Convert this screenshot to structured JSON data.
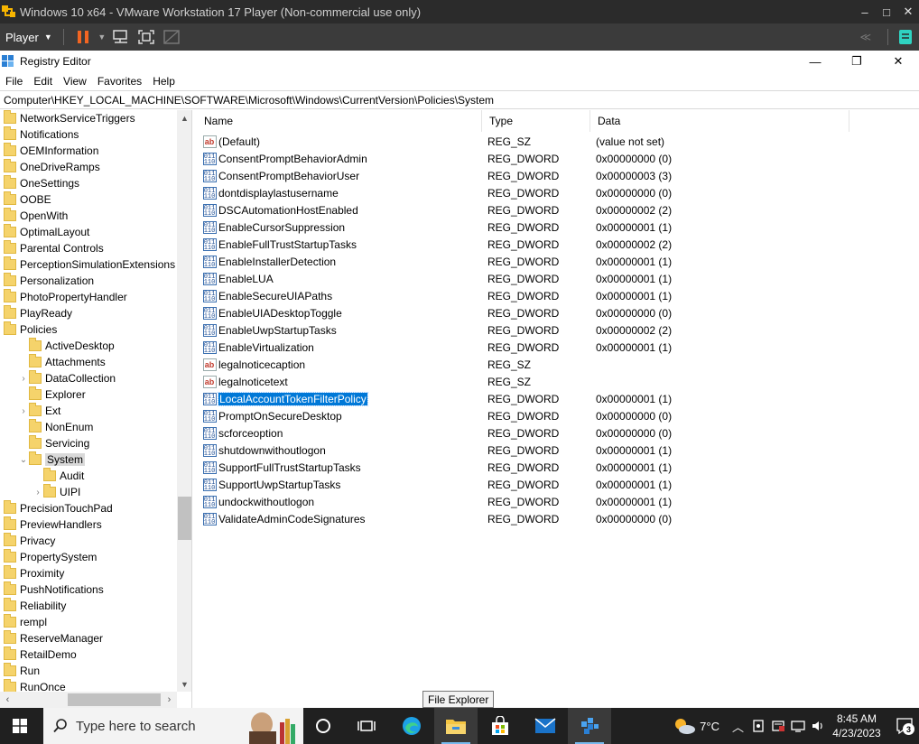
{
  "vm": {
    "title": "Windows 10 x64 - VMware Workstation 17 Player (Non-commercial use only)",
    "player_label": "Player",
    "win_controls": [
      "–",
      "□",
      "✕"
    ]
  },
  "regedit": {
    "title": "Registry Editor",
    "win_controls": [
      "—",
      "❐",
      "✕"
    ],
    "menu": [
      "File",
      "Edit",
      "View",
      "Favorites",
      "Help"
    ],
    "address": "Computer\\HKEY_LOCAL_MACHINE\\SOFTWARE\\Microsoft\\Windows\\CurrentVersion\\Policies\\System",
    "tree": [
      {
        "label": "NetworkServiceTriggers",
        "level": 0,
        "exp": ""
      },
      {
        "label": "Notifications",
        "level": 0,
        "exp": ""
      },
      {
        "label": "OEMInformation",
        "level": 0,
        "exp": ""
      },
      {
        "label": "OneDriveRamps",
        "level": 0,
        "exp": ""
      },
      {
        "label": "OneSettings",
        "level": 0,
        "exp": ""
      },
      {
        "label": "OOBE",
        "level": 0,
        "exp": ""
      },
      {
        "label": "OpenWith",
        "level": 0,
        "exp": ""
      },
      {
        "label": "OptimalLayout",
        "level": 0,
        "exp": ""
      },
      {
        "label": "Parental Controls",
        "level": 0,
        "exp": ""
      },
      {
        "label": "PerceptionSimulationExtensions",
        "level": 0,
        "exp": ""
      },
      {
        "label": "Personalization",
        "level": 0,
        "exp": ""
      },
      {
        "label": "PhotoPropertyHandler",
        "level": 0,
        "exp": ""
      },
      {
        "label": "PlayReady",
        "level": 0,
        "exp": ""
      },
      {
        "label": "Policies",
        "level": 0,
        "exp": ""
      },
      {
        "label": "ActiveDesktop",
        "level": 1,
        "exp": ""
      },
      {
        "label": "Attachments",
        "level": 1,
        "exp": ""
      },
      {
        "label": "DataCollection",
        "level": 1,
        "exp": "›"
      },
      {
        "label": "Explorer",
        "level": 1,
        "exp": ""
      },
      {
        "label": "Ext",
        "level": 1,
        "exp": "›"
      },
      {
        "label": "NonEnum",
        "level": 1,
        "exp": ""
      },
      {
        "label": "Servicing",
        "level": 1,
        "exp": ""
      },
      {
        "label": "System",
        "level": 1,
        "exp": "⌄",
        "selected": true
      },
      {
        "label": "Audit",
        "level": 2,
        "exp": ""
      },
      {
        "label": "UIPI",
        "level": 2,
        "exp": "›"
      },
      {
        "label": "PrecisionTouchPad",
        "level": 0,
        "exp": ""
      },
      {
        "label": "PreviewHandlers",
        "level": 0,
        "exp": ""
      },
      {
        "label": "Privacy",
        "level": 0,
        "exp": ""
      },
      {
        "label": "PropertySystem",
        "level": 0,
        "exp": ""
      },
      {
        "label": "Proximity",
        "level": 0,
        "exp": ""
      },
      {
        "label": "PushNotifications",
        "level": 0,
        "exp": ""
      },
      {
        "label": "Reliability",
        "level": 0,
        "exp": ""
      },
      {
        "label": "rempl",
        "level": 0,
        "exp": ""
      },
      {
        "label": "ReserveManager",
        "level": 0,
        "exp": ""
      },
      {
        "label": "RetailDemo",
        "level": 0,
        "exp": ""
      },
      {
        "label": "Run",
        "level": 0,
        "exp": ""
      },
      {
        "label": "RunOnce",
        "level": 0,
        "exp": ""
      }
    ],
    "columns": [
      "Name",
      "Type",
      "Data"
    ],
    "values": [
      {
        "name": "(Default)",
        "type": "REG_SZ",
        "data": "(value not set)",
        "icon": "string-value-icon"
      },
      {
        "name": "ConsentPromptBehaviorAdmin",
        "type": "REG_DWORD",
        "data": "0x00000000 (0)",
        "icon": "dword-value-icon"
      },
      {
        "name": "ConsentPromptBehaviorUser",
        "type": "REG_DWORD",
        "data": "0x00000003 (3)",
        "icon": "dword-value-icon"
      },
      {
        "name": "dontdisplaylastusername",
        "type": "REG_DWORD",
        "data": "0x00000000 (0)",
        "icon": "dword-value-icon"
      },
      {
        "name": "DSCAutomationHostEnabled",
        "type": "REG_DWORD",
        "data": "0x00000002 (2)",
        "icon": "dword-value-icon"
      },
      {
        "name": "EnableCursorSuppression",
        "type": "REG_DWORD",
        "data": "0x00000001 (1)",
        "icon": "dword-value-icon"
      },
      {
        "name": "EnableFullTrustStartupTasks",
        "type": "REG_DWORD",
        "data": "0x00000002 (2)",
        "icon": "dword-value-icon"
      },
      {
        "name": "EnableInstallerDetection",
        "type": "REG_DWORD",
        "data": "0x00000001 (1)",
        "icon": "dword-value-icon"
      },
      {
        "name": "EnableLUA",
        "type": "REG_DWORD",
        "data": "0x00000001 (1)",
        "icon": "dword-value-icon"
      },
      {
        "name": "EnableSecureUIAPaths",
        "type": "REG_DWORD",
        "data": "0x00000001 (1)",
        "icon": "dword-value-icon"
      },
      {
        "name": "EnableUIADesktopToggle",
        "type": "REG_DWORD",
        "data": "0x00000000 (0)",
        "icon": "dword-value-icon"
      },
      {
        "name": "EnableUwpStartupTasks",
        "type": "REG_DWORD",
        "data": "0x00000002 (2)",
        "icon": "dword-value-icon"
      },
      {
        "name": "EnableVirtualization",
        "type": "REG_DWORD",
        "data": "0x00000001 (1)",
        "icon": "dword-value-icon"
      },
      {
        "name": "legalnoticecaption",
        "type": "REG_SZ",
        "data": "",
        "icon": "string-value-icon"
      },
      {
        "name": "legalnoticetext",
        "type": "REG_SZ",
        "data": "",
        "icon": "string-value-icon"
      },
      {
        "name": "LocalAccountTokenFilterPolicy",
        "type": "REG_DWORD",
        "data": "0x00000001 (1)",
        "icon": "dword-value-icon",
        "selected": true
      },
      {
        "name": "PromptOnSecureDesktop",
        "type": "REG_DWORD",
        "data": "0x00000000 (0)",
        "icon": "dword-value-icon"
      },
      {
        "name": "scforceoption",
        "type": "REG_DWORD",
        "data": "0x00000000 (0)",
        "icon": "dword-value-icon"
      },
      {
        "name": "shutdownwithoutlogon",
        "type": "REG_DWORD",
        "data": "0x00000001 (1)",
        "icon": "dword-value-icon"
      },
      {
        "name": "SupportFullTrustStartupTasks",
        "type": "REG_DWORD",
        "data": "0x00000001 (1)",
        "icon": "dword-value-icon"
      },
      {
        "name": "SupportUwpStartupTasks",
        "type": "REG_DWORD",
        "data": "0x00000001 (1)",
        "icon": "dword-value-icon"
      },
      {
        "name": "undockwithoutlogon",
        "type": "REG_DWORD",
        "data": "0x00000001 (1)",
        "icon": "dword-value-icon"
      },
      {
        "name": "ValidateAdminCodeSignatures",
        "type": "REG_DWORD",
        "data": "0x00000000 (0)",
        "icon": "dword-value-icon"
      }
    ]
  },
  "tooltip": "File Explorer",
  "taskbar": {
    "search_placeholder": "Type here to search",
    "temperature": "7°C",
    "time": "8:45 AM",
    "date": "4/23/2023",
    "notification_count": "3"
  },
  "colors": {
    "selection": "#0078d7",
    "taskbar_bg": "#202020",
    "vm_title_bg": "#2b2b2b",
    "vm_toolbar_bg": "#3b3b3b",
    "pause_orange": "#f26522",
    "folder_yellow": "#f5d36b"
  }
}
